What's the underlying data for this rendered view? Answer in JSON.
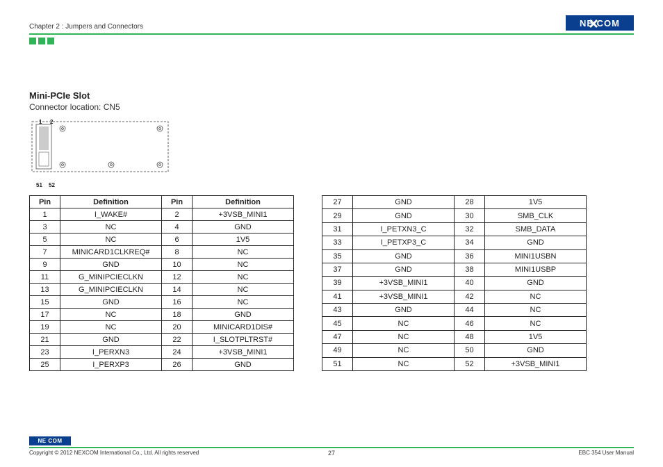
{
  "header": {
    "chapter": "Chapter 2 : Jumpers and Connectors",
    "brand": "NE COM"
  },
  "section": {
    "title": "Mini-PCIe Slot",
    "subtitle": "Connector location: CN5",
    "pin1": "1",
    "pin2": "2",
    "pin51": "51",
    "pin52": "52"
  },
  "table": {
    "headers": {
      "pin": "Pin",
      "def": "Definition"
    },
    "left": [
      {
        "p1": "1",
        "d1": "I_WAKE#",
        "p2": "2",
        "d2": "+3VSB_MINI1"
      },
      {
        "p1": "3",
        "d1": "NC",
        "p2": "4",
        "d2": "GND"
      },
      {
        "p1": "5",
        "d1": "NC",
        "p2": "6",
        "d2": "1V5"
      },
      {
        "p1": "7",
        "d1": "MINICARD1CLKREQ#",
        "p2": "8",
        "d2": "NC"
      },
      {
        "p1": "9",
        "d1": "GND",
        "p2": "10",
        "d2": "NC"
      },
      {
        "p1": "11",
        "d1": "G_MINIPCIECLKN",
        "p2": "12",
        "d2": "NC"
      },
      {
        "p1": "13",
        "d1": "G_MINIPCIECLKN",
        "p2": "14",
        "d2": "NC"
      },
      {
        "p1": "15",
        "d1": "GND",
        "p2": "16",
        "d2": "NC"
      },
      {
        "p1": "17",
        "d1": "NC",
        "p2": "18",
        "d2": "GND"
      },
      {
        "p1": "19",
        "d1": "NC",
        "p2": "20",
        "d2": "MINICARD1DIS#"
      },
      {
        "p1": "21",
        "d1": "GND",
        "p2": "22",
        "d2": "I_SLOTPLTRST#"
      },
      {
        "p1": "23",
        "d1": "I_PERXN3",
        "p2": "24",
        "d2": "+3VSB_MINI1"
      },
      {
        "p1": "25",
        "d1": "I_PERXP3",
        "p2": "26",
        "d2": "GND"
      }
    ],
    "right": [
      {
        "p1": "27",
        "d1": "GND",
        "p2": "28",
        "d2": "1V5"
      },
      {
        "p1": "29",
        "d1": "GND",
        "p2": "30",
        "d2": "SMB_CLK"
      },
      {
        "p1": "31",
        "d1": "I_PETXN3_C",
        "p2": "32",
        "d2": "SMB_DATA"
      },
      {
        "p1": "33",
        "d1": "I_PETXP3_C",
        "p2": "34",
        "d2": "GND"
      },
      {
        "p1": "35",
        "d1": "GND",
        "p2": "36",
        "d2": "MINI1USBN"
      },
      {
        "p1": "37",
        "d1": "GND",
        "p2": "38",
        "d2": "MINI1USBP"
      },
      {
        "p1": "39",
        "d1": "+3VSB_MINI1",
        "p2": "40",
        "d2": "GND"
      },
      {
        "p1": "41",
        "d1": "+3VSB_MINI1",
        "p2": "42",
        "d2": "NC"
      },
      {
        "p1": "43",
        "d1": "GND",
        "p2": "44",
        "d2": "NC"
      },
      {
        "p1": "45",
        "d1": "NC",
        "p2": "46",
        "d2": "NC"
      },
      {
        "p1": "47",
        "d1": "NC",
        "p2": "48",
        "d2": "1V5"
      },
      {
        "p1": "49",
        "d1": "NC",
        "p2": "50",
        "d2": "GND"
      },
      {
        "p1": "51",
        "d1": "NC",
        "p2": "52",
        "d2": "+3VSB_MINI1"
      }
    ]
  },
  "footer": {
    "logo": "NE COM",
    "copyright": "Copyright © 2012 NEXCOM International Co., Ltd. All rights reserved",
    "page": "27",
    "doc": "EBC 354 User Manual"
  }
}
